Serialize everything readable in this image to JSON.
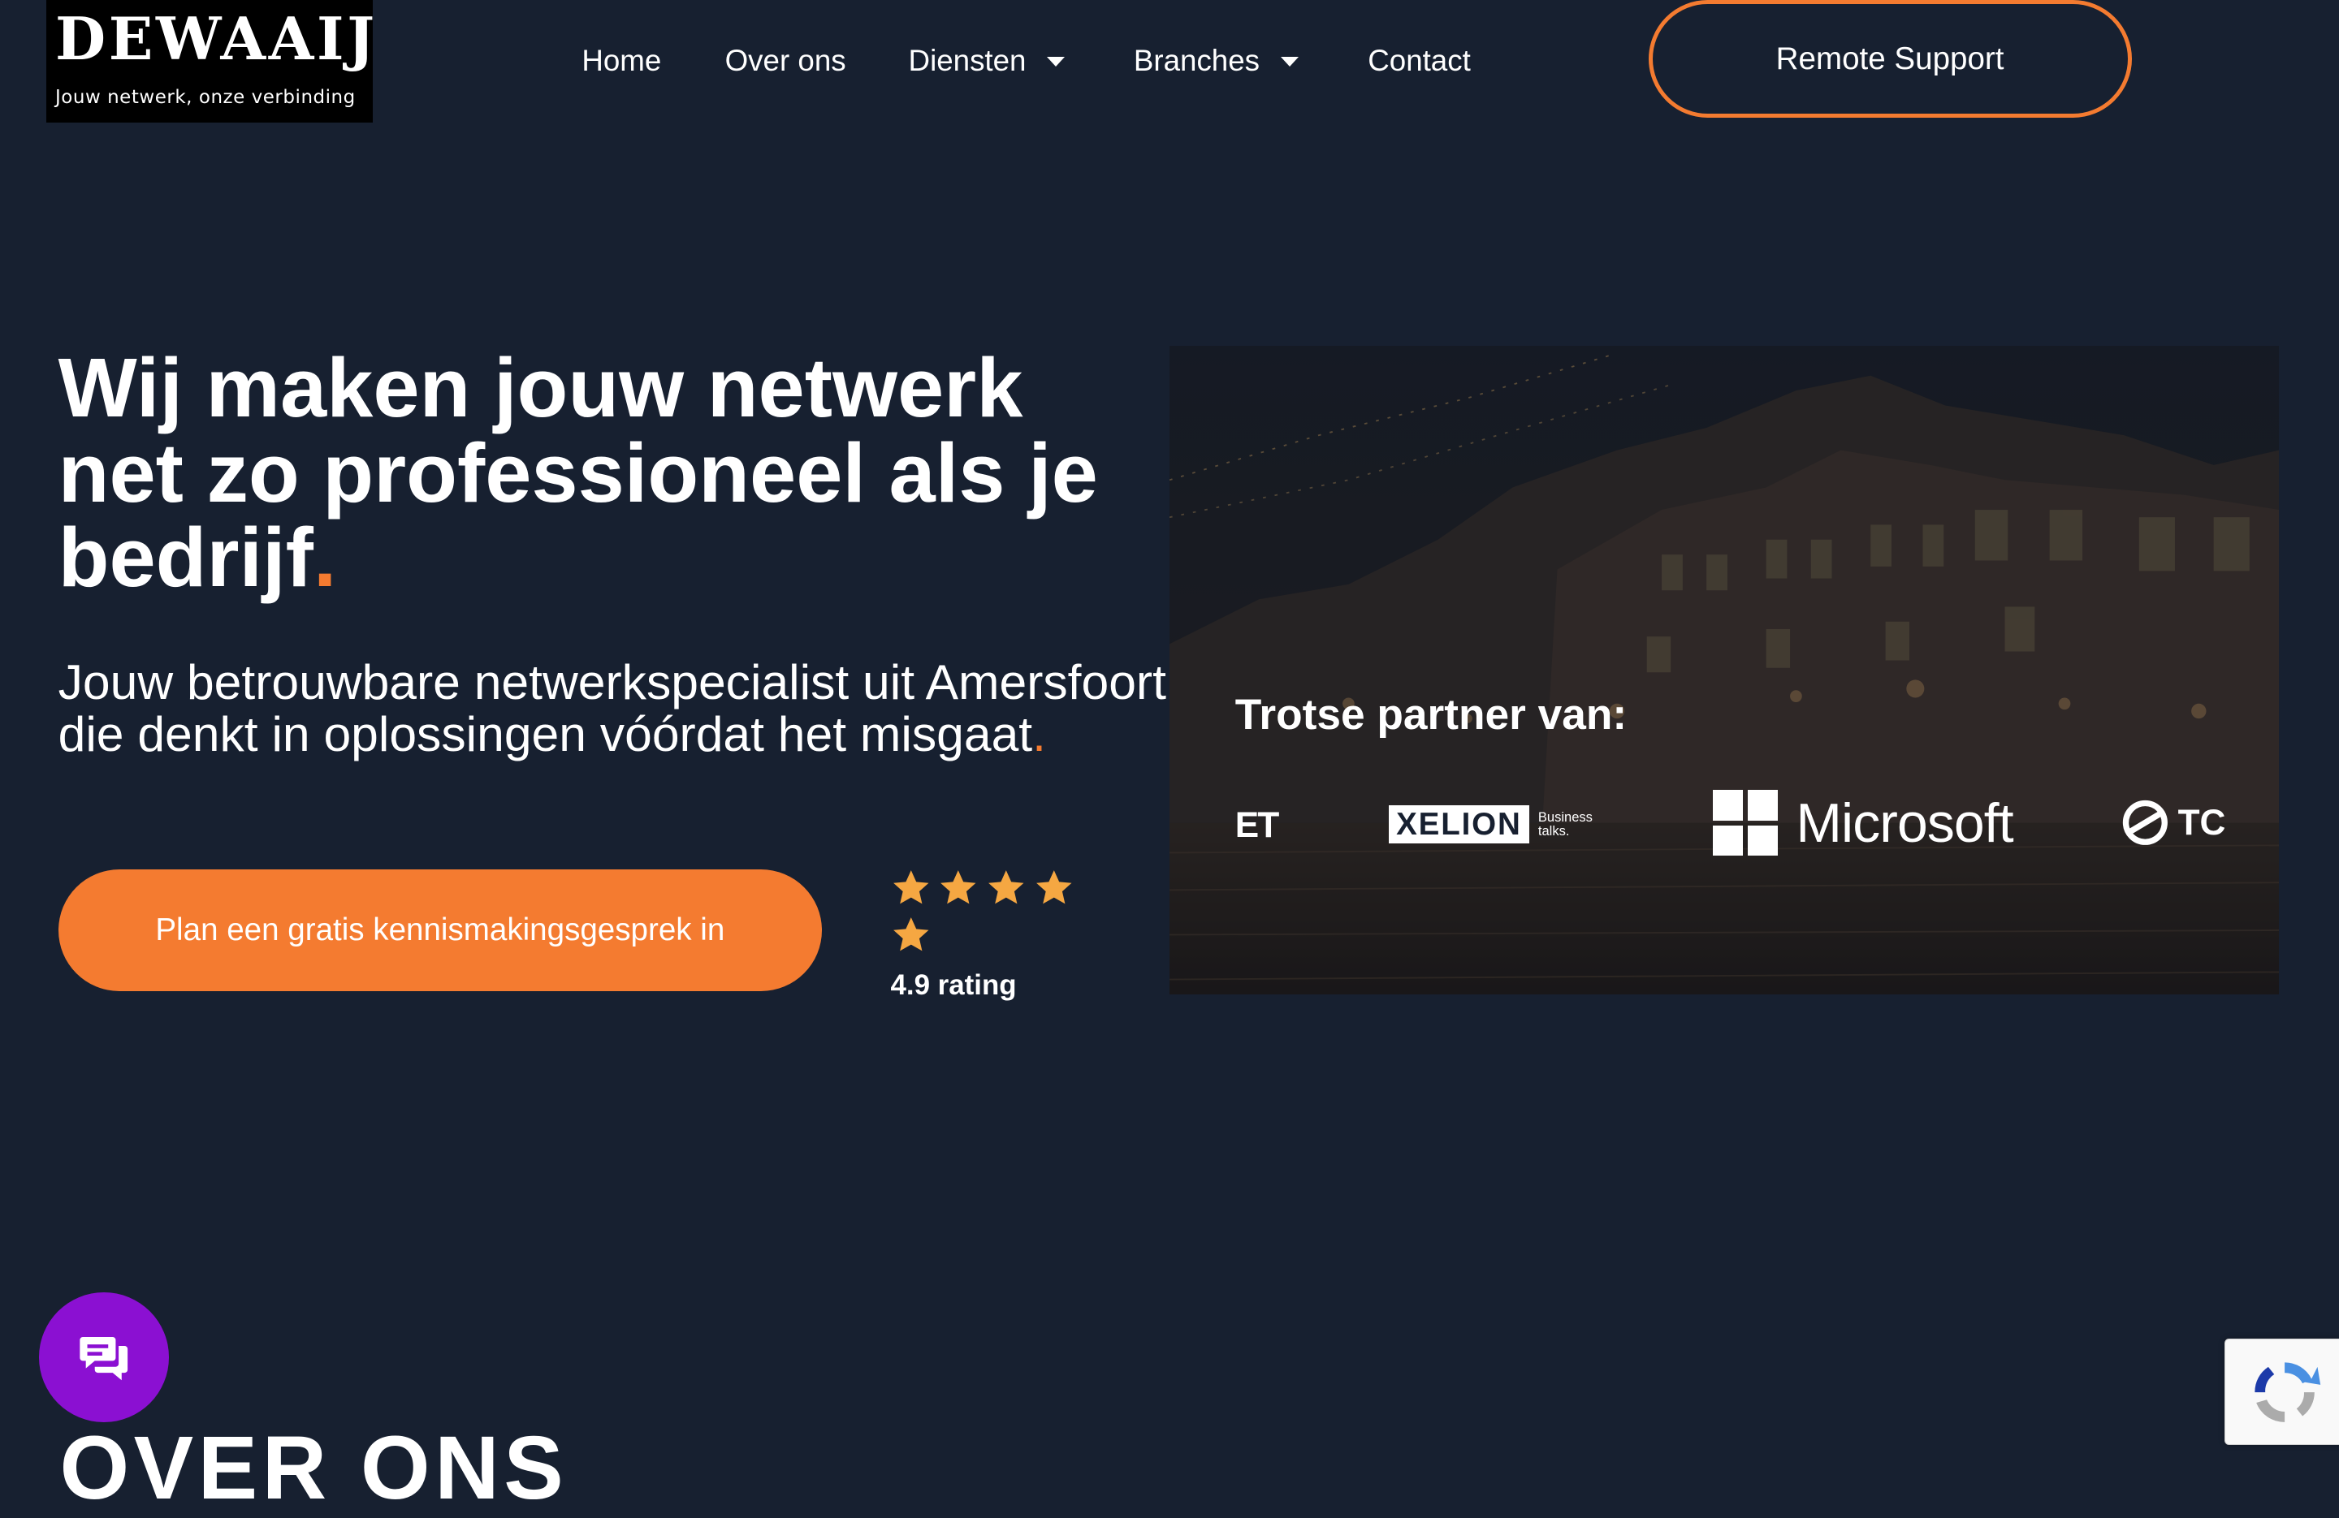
{
  "logo": {
    "title": "DEWAAIJ",
    "tagline": "Jouw netwerk, onze verbinding"
  },
  "nav": {
    "items": [
      {
        "label": "Home"
      },
      {
        "label": "Over ons"
      },
      {
        "label": "Diensten",
        "dropdown": true
      },
      {
        "label": "Branches",
        "dropdown": true
      },
      {
        "label": "Contact"
      }
    ],
    "remote_support": "Remote Support"
  },
  "hero": {
    "title": "Wij maken jouw netwerk net zo professioneel als je bedrijf",
    "title_dot": ".",
    "subtitle": "Jouw betrouwbare netwerkspecialist uit Amersfoort die denkt in oplossingen vóórdat het misgaat",
    "subtitle_dot": ".",
    "cta": "Plan een gratis kennismakingsgesprek in",
    "rating_text": "4.9 rating",
    "stars": 5
  },
  "partners": {
    "title": "Trotse partner van:",
    "logos": [
      {
        "name": "ET",
        "text": "ET"
      },
      {
        "name": "Xelion",
        "text": "XELION",
        "side_top": "Business",
        "side_bottom": "talks."
      },
      {
        "name": "Microsoft",
        "text": "Microsoft"
      },
      {
        "name": "TC",
        "text": "TC"
      }
    ]
  },
  "next_section": {
    "heading": "OVER ONS"
  },
  "colors": {
    "background": "#172030",
    "accent": "#f47b30",
    "chat": "#8b10d2",
    "star": "#f5a742"
  },
  "icons": {
    "chat": "chat-bubble-icon",
    "recaptcha": "recaptcha-icon",
    "star": "star-icon",
    "caret": "caret-down-icon"
  }
}
